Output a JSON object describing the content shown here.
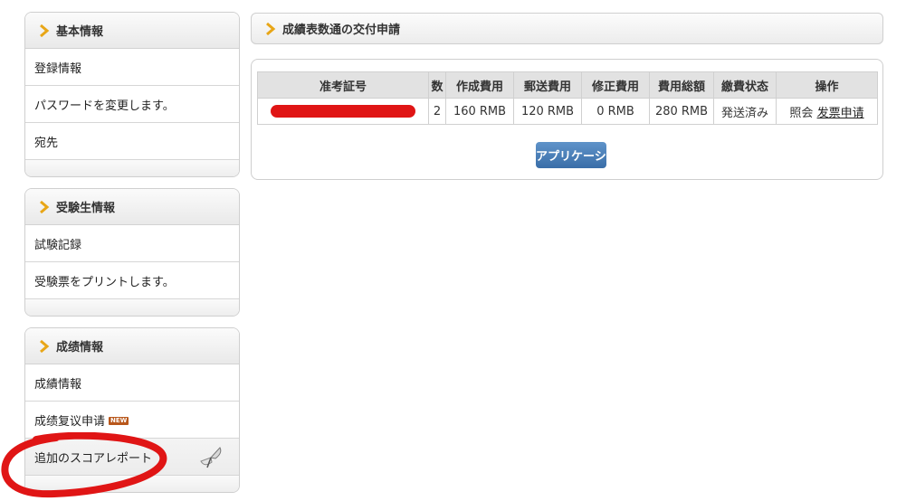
{
  "sidebar": {
    "basic": {
      "title": "基本情報",
      "items": [
        "登録情報",
        "パスワードを変更します。",
        "宛先"
      ]
    },
    "candidate": {
      "title": "受験生情報",
      "items": [
        "試験記録",
        "受験票をプリントします。"
      ]
    },
    "scores": {
      "title": "成绩情報",
      "items": [
        "成績情報",
        "成绩复议申请",
        "追加のスコアレポート"
      ],
      "new_badge": "NEW"
    }
  },
  "main": {
    "title": "成績表数通の交付申請",
    "table": {
      "headers": [
        "准考証号",
        "数",
        "作成費用",
        "郵送費用",
        "修正費用",
        "費用総額",
        "繳費状态",
        "操作"
      ],
      "rows": [
        {
          "count": "2",
          "creation_fee": "160 RMB",
          "postage_fee": "120 RMB",
          "correction_fee": "0 RMB",
          "total_fee": "280 RMB",
          "status": "発送済み",
          "action_inquiry": "照会",
          "action_invoice": "发票申请"
        }
      ]
    },
    "apply_button": "アプリケーション"
  },
  "colors": {
    "accent_arrow": "#e8a617",
    "button_blue": "#3a6ea8",
    "annotation_red": "#e01515"
  }
}
